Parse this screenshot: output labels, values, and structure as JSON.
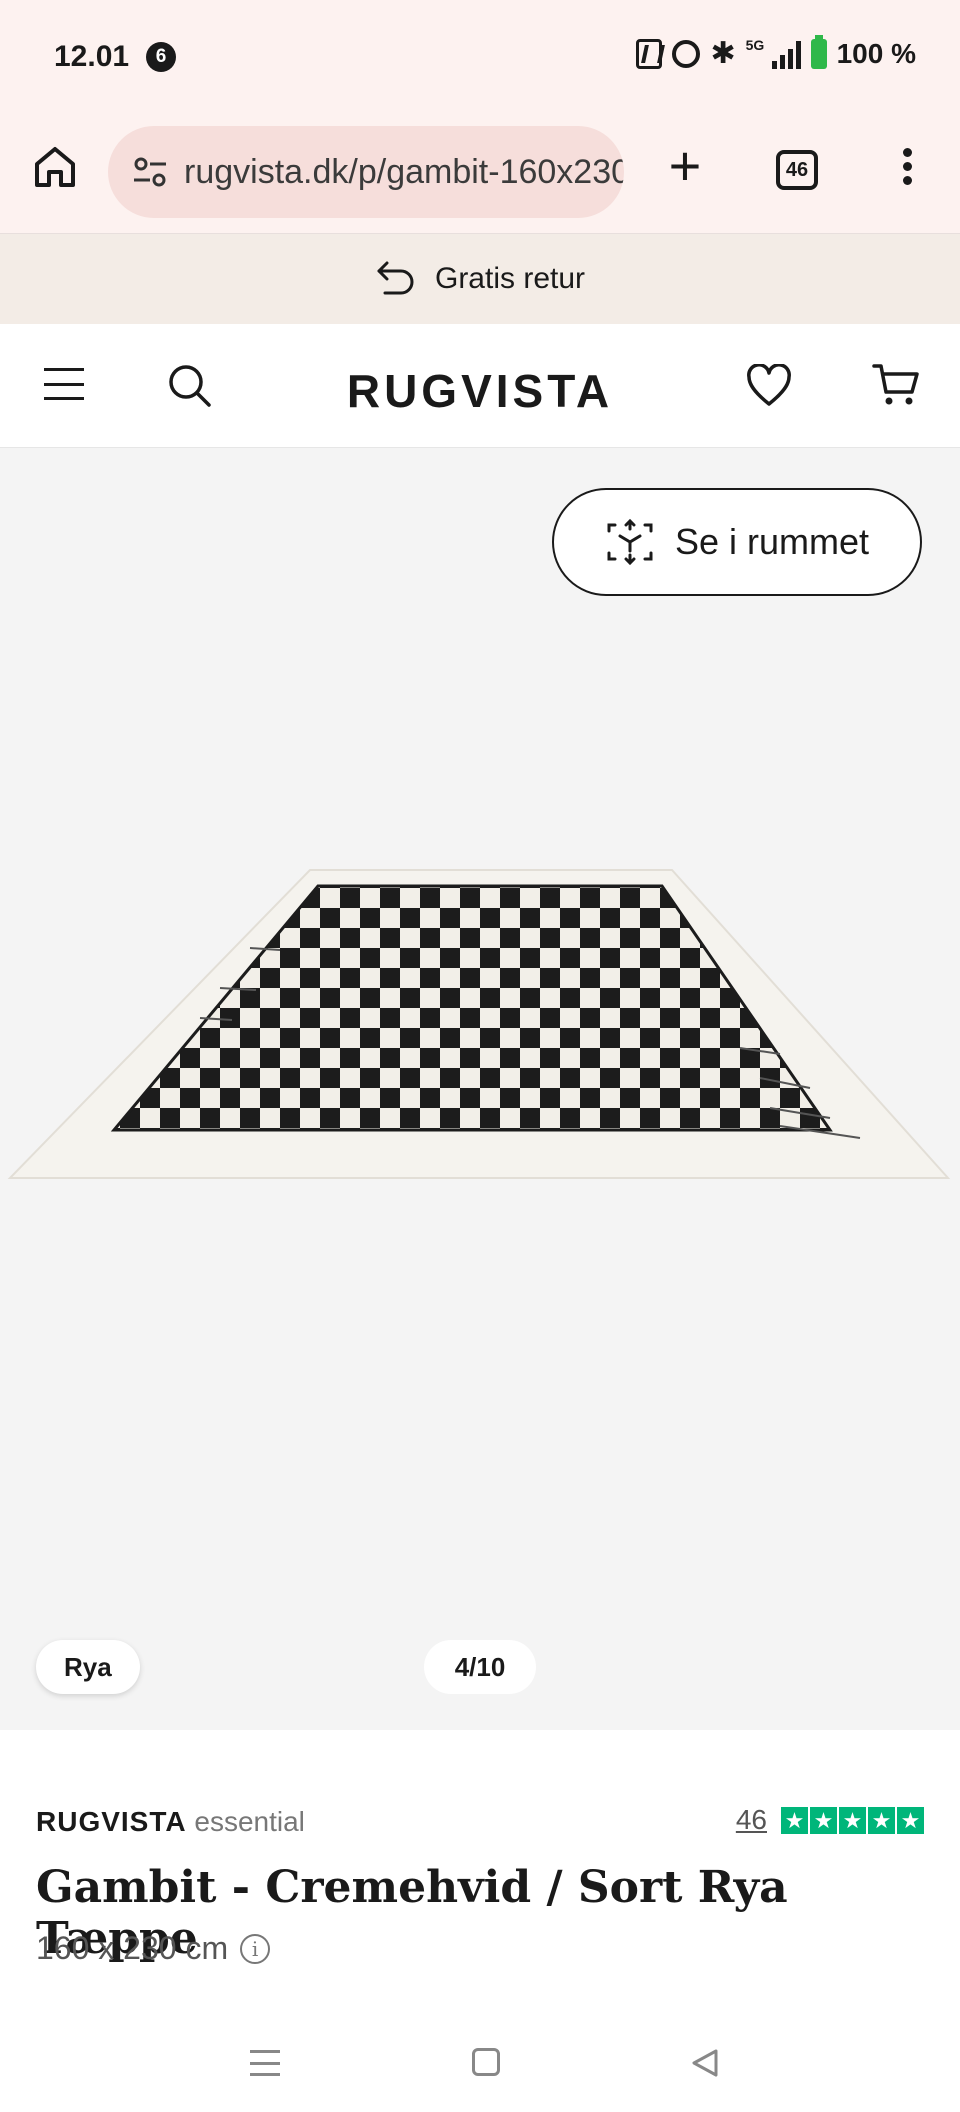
{
  "status": {
    "time": "12.01",
    "notification_count": "6",
    "network": "5G",
    "battery": "100 %"
  },
  "browser": {
    "url": "rugvista.dk/p/gambit-160x230",
    "tab_count": "46"
  },
  "promo": {
    "text": "Gratis retur"
  },
  "header": {
    "logo": "RUGVISTA"
  },
  "gallery": {
    "ar_button_label": "Se i rummet",
    "tag": "Rya",
    "counter": "4/10"
  },
  "product": {
    "brand": "RUGVISTA",
    "brand_line": "essential",
    "review_count": "46",
    "stars": 5,
    "title": "Gambit - Cremehvid / Sort Rya Tæppe",
    "size": "160 x 230 cm"
  },
  "colors": {
    "accent_trustpilot": "#00b67a",
    "browser_bg": "#fdf2f0",
    "promo_bg": "#f3ece6",
    "gallery_bg": "#f4f4f4"
  },
  "icons": {
    "home": "home-icon",
    "site_settings": "tune-icon",
    "new_tab": "plus-icon",
    "tabs": "tabs-icon",
    "more": "more-vertical-icon",
    "return": "return-arrow-icon",
    "menu": "hamburger-icon",
    "search": "search-icon",
    "wishlist": "heart-icon",
    "cart": "cart-icon",
    "ar": "ar-cube-icon",
    "info": "info-icon"
  }
}
